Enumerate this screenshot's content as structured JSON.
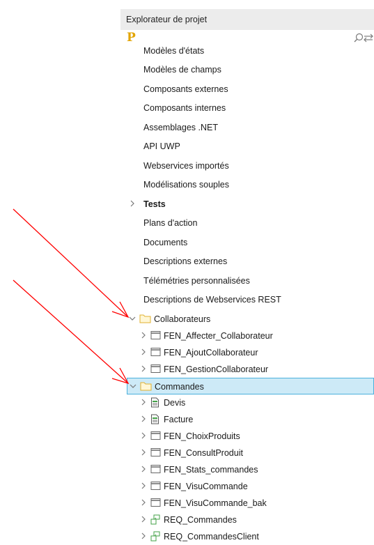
{
  "panel": {
    "title": "Explorateur de projet",
    "logo": "P"
  },
  "toolbar": {
    "icons": [
      "search-icon",
      "sync-icon"
    ]
  },
  "cut_item": "Modèles d'états",
  "plain_items": [
    "Modèles de champs",
    "Composants externes",
    "Composants internes",
    "Assemblages .NET",
    "API UWP",
    "Webservices importés",
    "Modélisations souples"
  ],
  "tests": "Tests",
  "plain_items2": [
    "Plans d'action",
    "Documents",
    "Descriptions externes",
    "Télémétries personnalisées",
    "Descriptions de Webservices REST"
  ],
  "collaborateurs": {
    "label": "Collaborateurs",
    "children": [
      "FEN_Affecter_Collaborateur",
      "FEN_AjoutCollaborateur",
      "FEN_GestionCollaborateur"
    ]
  },
  "commandes": {
    "label": "Commandes",
    "children": [
      {
        "label": "Devis",
        "icon": "report-icon"
      },
      {
        "label": "Facture",
        "icon": "report-icon"
      },
      {
        "label": "FEN_ChoixProduits",
        "icon": "window-icon"
      },
      {
        "label": "FEN_ConsultProduit",
        "icon": "window-icon"
      },
      {
        "label": "FEN_Stats_commandes",
        "icon": "window-icon"
      },
      {
        "label": "FEN_VisuCommande",
        "icon": "window-icon"
      },
      {
        "label": "FEN_VisuCommande_bak",
        "icon": "window-icon"
      },
      {
        "label": "REQ_Commandes",
        "icon": "query-icon"
      },
      {
        "label": "REQ_CommandesClient",
        "icon": "query-icon"
      }
    ]
  },
  "colors": {
    "selection": "#cdeaf7",
    "selection_border": "#4ab0dc",
    "annotation": "#ff0000",
    "folder": "#f2c94c"
  }
}
